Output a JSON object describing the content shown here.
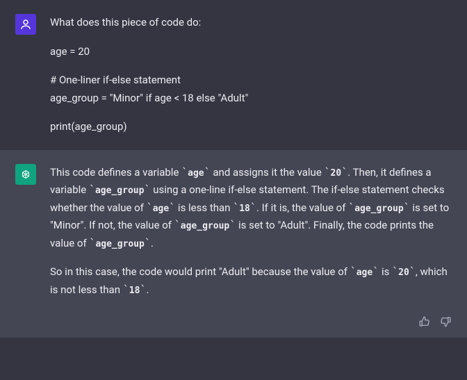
{
  "user": {
    "line1": "What does this piece of code do:",
    "code1": "age = 20",
    "code2": "# One-liner if-else statement",
    "code3": "age_group = \"Minor\" if age < 18 else \"Adult\"",
    "code4": "print(age_group)"
  },
  "assistant": {
    "p1": {
      "t1": "This code defines a variable ",
      "c1": "age",
      "t2": " and assigns it the value ",
      "c2": "20",
      "t3": ". Then, it defines a variable ",
      "c3": "age_group",
      "t4": " using a one-line if-else statement. The if-else statement checks whether the value of ",
      "c4": "age",
      "t5": " is less than ",
      "c5": "18",
      "t6": ". If it is, the value of ",
      "c6": "age_group",
      "t7": " is set to \"Minor\". If not, the value of ",
      "c7": "age_group",
      "t8": " is set to \"Adult\". Finally, the code prints the value of ",
      "c8": "age_group",
      "t9": "."
    },
    "p2": {
      "t1": "So in this case, the code would print \"Adult\" because the value of ",
      "c1": "age",
      "t2": " is ",
      "c2": "20",
      "t3": ", which is not less than ",
      "c3": "18",
      "t4": "."
    }
  }
}
